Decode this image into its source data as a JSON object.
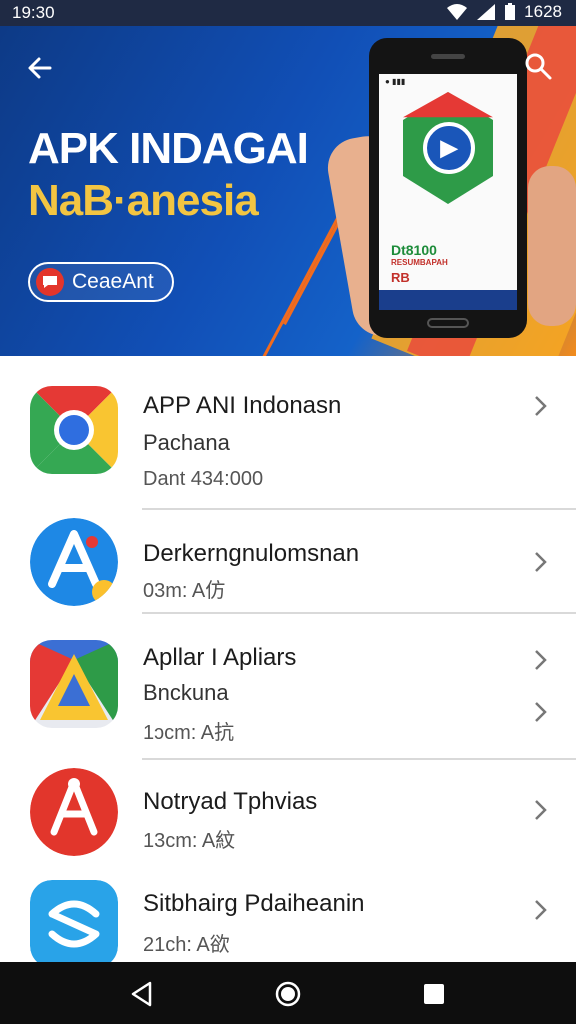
{
  "status_bar": {
    "time": "19:30",
    "clock_right": "1628",
    "icons": [
      "wifi-icon",
      "signal-icon",
      "battery-icon"
    ]
  },
  "hero": {
    "title": "APK INDAGAI",
    "subtitle": "NaB·anesia",
    "button_label": "CeaeAnt",
    "phone_screen": {
      "brand": "Dt8100",
      "tag": "RESUMBAPAH",
      "code": "RB"
    }
  },
  "apps": [
    {
      "name": "APP ANI Indonasn",
      "sub": "Pachana",
      "meta": "Dant 434:000",
      "icon": "chrome-style-icon"
    },
    {
      "name": "Derkerngnulomsnan",
      "sub": "",
      "meta": "03m: A仿",
      "icon": "app-store-a-icon"
    },
    {
      "name": "Apllar I Apliars",
      "sub": "Bnckuna",
      "meta": "1ɔcm: A抗",
      "icon": "drive-triangle-icon"
    },
    {
      "name": "Notryad Tphvias",
      "sub": "",
      "meta": "13cm: A紋",
      "icon": "red-a-icon"
    },
    {
      "name": "Sitbhairg Pdaiheanin",
      "sub": "",
      "meta": "21ch: A欲",
      "icon": "blue-swirl-icon"
    }
  ],
  "navigation": {
    "back": "back-triangle-icon",
    "home": "home-circle-icon",
    "recents": "recents-square-icon"
  },
  "colors": {
    "hero_blue": "#114fb6",
    "accent_yellow": "#f3c542",
    "accent_red": "#e3352b",
    "accent_orange": "#f5a623"
  }
}
